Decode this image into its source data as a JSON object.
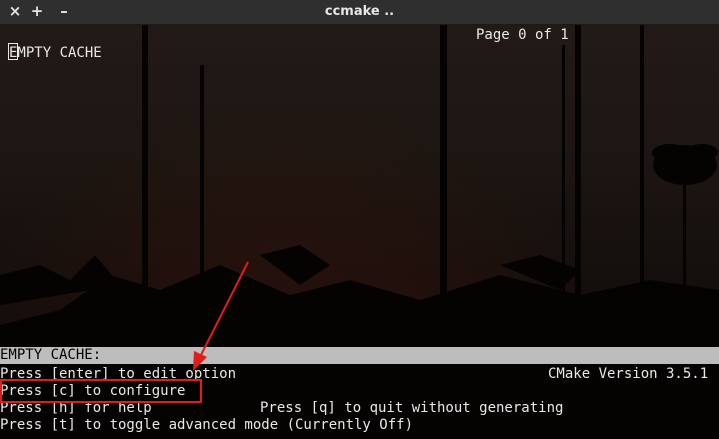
{
  "window": {
    "title": "ccmake ..",
    "buttons": [
      "×",
      "+",
      "–"
    ]
  },
  "terminal": {
    "cache_header": "EMPTY CACHE",
    "page_indicator": "Page 0 of 1",
    "status_label": "EMPTY CACHE:",
    "help_lines": {
      "enter": "Press [enter] to edit option",
      "version": "CMake Version 3.5.1",
      "configure": "Press [c] to configure",
      "help": "Press [h] for help",
      "quit": "Press [q] to quit without generating",
      "toggle": "Press [t] to toggle advanced mode (Currently Off)"
    }
  },
  "annotation": {
    "color": "#e21b1b"
  }
}
